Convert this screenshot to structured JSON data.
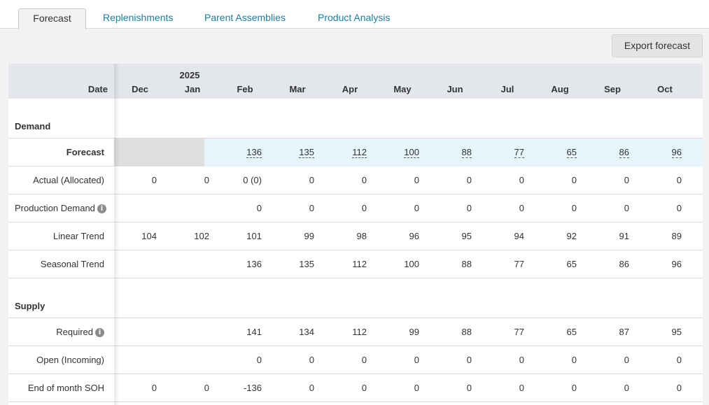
{
  "tabs": {
    "forecast": "Forecast",
    "replenishments": "Replenishments",
    "parent_assemblies": "Parent Assemblies",
    "product_analysis": "Product Analysis"
  },
  "export_label": "Export forecast",
  "header": {
    "date_label": "Date",
    "year": "2025",
    "months": [
      "Dec",
      "Jan",
      "Feb",
      "Mar",
      "Apr",
      "May",
      "Jun",
      "Jul",
      "Aug",
      "Sep",
      "Oct"
    ]
  },
  "sections": {
    "demand": "Demand",
    "supply": "Supply"
  },
  "rows": {
    "forecast": {
      "label": "Forecast",
      "values": [
        "",
        "",
        "136",
        "135",
        "112",
        "100",
        "88",
        "77",
        "65",
        "86",
        "96"
      ]
    },
    "actual": {
      "label": "Actual (Allocated)",
      "values": [
        "0",
        "0",
        "0 (0)",
        "0",
        "0",
        "0",
        "0",
        "0",
        "0",
        "0",
        "0"
      ]
    },
    "production_demand": {
      "label": "Production Demand",
      "values": [
        "",
        "",
        "0",
        "0",
        "0",
        "0",
        "0",
        "0",
        "0",
        "0",
        "0"
      ]
    },
    "linear_trend": {
      "label": "Linear Trend",
      "values": [
        "104",
        "102",
        "101",
        "99",
        "98",
        "96",
        "95",
        "94",
        "92",
        "91",
        "89"
      ]
    },
    "seasonal_trend": {
      "label": "Seasonal Trend",
      "values": [
        "",
        "",
        "136",
        "135",
        "112",
        "100",
        "88",
        "77",
        "65",
        "86",
        "96"
      ]
    },
    "required": {
      "label": "Required",
      "values": [
        "",
        "",
        "141",
        "134",
        "112",
        "99",
        "88",
        "77",
        "65",
        "87",
        "95"
      ]
    },
    "open_incoming": {
      "label": "Open (Incoming)",
      "values": [
        "",
        "",
        "0",
        "0",
        "0",
        "0",
        "0",
        "0",
        "0",
        "0",
        "0"
      ]
    },
    "end_of_month_soh": {
      "label": "End of month SOH",
      "values": [
        "0",
        "0",
        "-136",
        "0",
        "0",
        "0",
        "0",
        "0",
        "0",
        "0",
        "0"
      ]
    }
  },
  "icons": {
    "info": "info-icon"
  },
  "colors": {
    "link": "#1a7ea5",
    "header_bg": "#e3e6ea",
    "forecast_highlight": "#e6f4fb",
    "forecast_locked": "#dedede"
  }
}
